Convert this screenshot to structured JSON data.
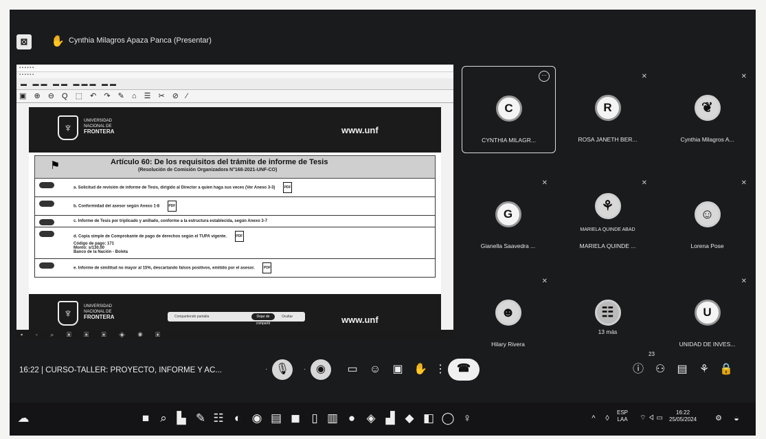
{
  "header": {
    "presenter_title": "Cynthia Milagros Apaza Panca (Presentar)",
    "app_icon": "app-icon",
    "presenter_icon": "presenter-icon"
  },
  "shared_screen": {
    "document": {
      "website": "www.unf",
      "university_line1": "UNIVERSIDAD",
      "university_line2": "NACIONAL DE",
      "university_name": "FRONTERA",
      "article_title": "Artículo 60: De los requisitos del trámite de informe de Tesis",
      "article_subtitle": "(Resolución de Comisión Organizadora N°168-2021-UNF-CO)",
      "requirements": [
        "a. Solicitud de revisión de informe de Tesis, dirigido al Director a quien haga sus veces (Ver Anexo 3-3)",
        "b. Conformidad del asesor según Anexo 1-8",
        "c. Informe de Tesis por triplicado y anillado, conforme a la estructura establecida, según Anexo 3-7",
        "d. Copia simple de Comprobante de pago de derechos según el TUPA vigente.",
        "e. Informe de similitud no mayor al 15%, descartando falsos positivos, emitido por el asesor."
      ],
      "payment_details": [
        "Código de pago: 171",
        "Monto: s/130.00",
        "Banco de la Nación - Boleta"
      ],
      "pdf_label": "PDF"
    },
    "share_bar": {
      "text": "Compartiendo pantalla",
      "stop_label": "Dejar de compartir",
      "hide_label": "Ocultar"
    }
  },
  "participants": [
    {
      "name": "CYNTHIA MILAGR...",
      "initial": "C",
      "active": true
    },
    {
      "name": "ROSA JANETH BER...",
      "initial": "R",
      "active": false
    },
    {
      "name": "Cynthia Milagros A...",
      "initial": "",
      "active": false
    },
    {
      "name": "Gianella Saavedra ...",
      "initial": "G",
      "active": false
    },
    {
      "name": "MARIELA QUINDE ...",
      "initial": "",
      "caption": "MARIELA QUINDE ABAD",
      "active": false
    },
    {
      "name": "Lorena Pose",
      "initial": "",
      "active": false
    },
    {
      "name": "Hilary Rivera",
      "initial": "",
      "active": false
    },
    {
      "name": "13 más",
      "initial": "",
      "active": false
    },
    {
      "name": "UNIDAD DE INVES...",
      "initial": "U",
      "active": false
    }
  ],
  "meeting_bar": {
    "time": "16:22",
    "separator": "|",
    "meeting_name": "CURSO-TALLER: PROYECTO, INFORME Y AC...",
    "people_count": "23"
  },
  "taskbar": {
    "lang_line1": "ESP",
    "lang_line2": "LAA",
    "clock_time": "16:22",
    "clock_date": "25/05/2024"
  }
}
